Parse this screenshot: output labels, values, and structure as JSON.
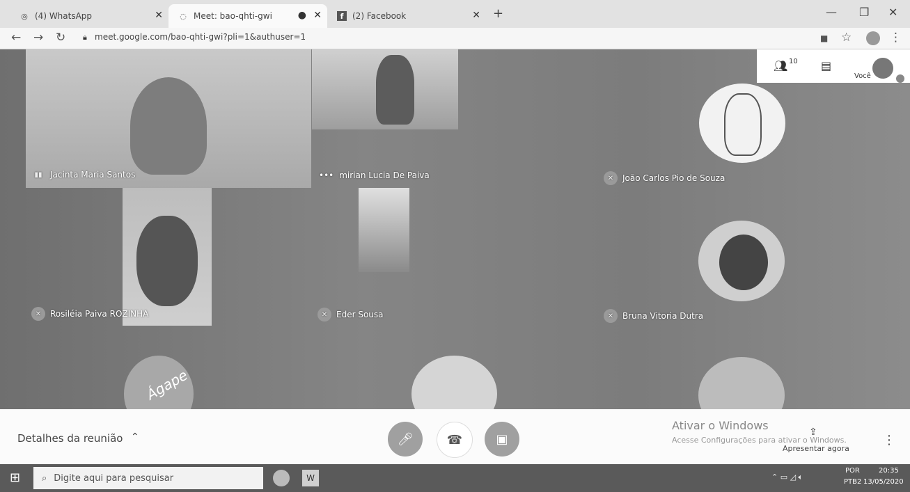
{
  "browser": {
    "tabs": [
      {
        "label": "(4) WhatsApp"
      },
      {
        "label": "Meet: bao-qhti-gwi"
      },
      {
        "label": "(2) Facebook"
      }
    ],
    "new_tab_label": "+",
    "url": "meet.google.com/bao-qhti-gwi?pli=1&authuser=1"
  },
  "meet": {
    "participants_count": "10",
    "self_label": "Você",
    "participants": [
      {
        "name": "Jacinta Maria Santos"
      },
      {
        "name": "mirian Lucia De Paiva"
      },
      {
        "name": "João Carlos Pio de Souza"
      },
      {
        "name": "Rosiléia Paiva ROZINHA"
      },
      {
        "name": "Eder Sousa"
      },
      {
        "name": "Bruna Vitoria Dutra"
      }
    ],
    "avatar_text": "Ágape",
    "meeting_details_label": "Detalhes da reunião",
    "present_now_label": "Apresentar agora",
    "watermark_title": "Ativar o Windows",
    "watermark_sub": "Acesse Configurações para ativar o Windows."
  },
  "taskbar": {
    "search_placeholder": "Digite aqui para pesquisar",
    "lang_top": "POR",
    "lang_bottom": "PTB2",
    "time": "20:35",
    "date": "13/05/2020"
  }
}
